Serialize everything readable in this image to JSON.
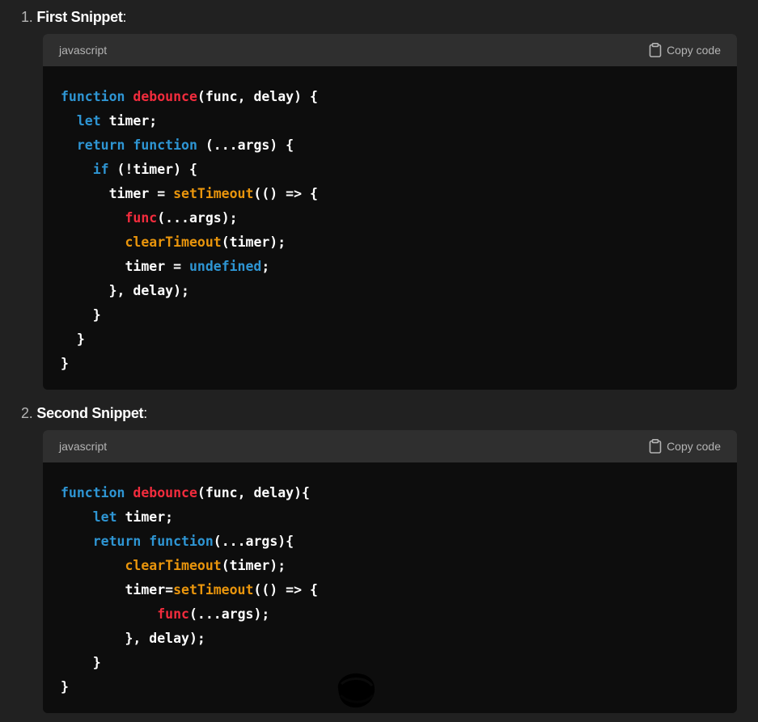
{
  "colors": {
    "background": "#212121",
    "code_background": "#0d0d0d",
    "header_background": "#2f2f2f",
    "keyword": "#2e95d3",
    "function_name": "#f22c3d",
    "builtin": "#e9950c",
    "plain": "#ffffff"
  },
  "snippets": [
    {
      "number": "1.",
      "title": "First Snippet",
      "colon": ":",
      "language": "javascript",
      "copy_label": "Copy code",
      "lines": [
        [
          {
            "t": "function",
            "c": "kw"
          },
          {
            "t": " ",
            "c": "pl"
          },
          {
            "t": "debounce",
            "c": "fn"
          },
          {
            "t": "(func, delay) {",
            "c": "pl"
          }
        ],
        [
          {
            "t": "  ",
            "c": "pl"
          },
          {
            "t": "let",
            "c": "kw"
          },
          {
            "t": " timer;",
            "c": "pl"
          }
        ],
        [
          {
            "t": "  ",
            "c": "pl"
          },
          {
            "t": "return",
            "c": "kw"
          },
          {
            "t": " ",
            "c": "pl"
          },
          {
            "t": "function",
            "c": "kw"
          },
          {
            "t": " (...args) {",
            "c": "pl"
          }
        ],
        [
          {
            "t": "    ",
            "c": "pl"
          },
          {
            "t": "if",
            "c": "kw"
          },
          {
            "t": " (!timer) {",
            "c": "pl"
          }
        ],
        [
          {
            "t": "      timer = ",
            "c": "pl"
          },
          {
            "t": "setTimeout",
            "c": "bi"
          },
          {
            "t": "(() => {",
            "c": "pl"
          }
        ],
        [
          {
            "t": "        ",
            "c": "pl"
          },
          {
            "t": "func",
            "c": "fn"
          },
          {
            "t": "(...args);",
            "c": "pl"
          }
        ],
        [
          {
            "t": "        ",
            "c": "pl"
          },
          {
            "t": "clearTimeout",
            "c": "bi"
          },
          {
            "t": "(timer);",
            "c": "pl"
          }
        ],
        [
          {
            "t": "        timer = ",
            "c": "pl"
          },
          {
            "t": "undefined",
            "c": "kw"
          },
          {
            "t": ";",
            "c": "pl"
          }
        ],
        [
          {
            "t": "      }, delay);",
            "c": "pl"
          }
        ],
        [
          {
            "t": "    }",
            "c": "pl"
          }
        ],
        [
          {
            "t": "  }",
            "c": "pl"
          }
        ],
        [
          {
            "t": "}",
            "c": "pl"
          }
        ]
      ]
    },
    {
      "number": "2.",
      "title": "Second Snippet",
      "colon": ":",
      "language": "javascript",
      "copy_label": "Copy code",
      "lines": [
        [
          {
            "t": "function",
            "c": "kw"
          },
          {
            "t": " ",
            "c": "pl"
          },
          {
            "t": "debounce",
            "c": "fn"
          },
          {
            "t": "(func, delay){",
            "c": "pl"
          }
        ],
        [
          {
            "t": "    ",
            "c": "pl"
          },
          {
            "t": "let",
            "c": "kw"
          },
          {
            "t": " timer;",
            "c": "pl"
          }
        ],
        [
          {
            "t": "    ",
            "c": "pl"
          },
          {
            "t": "return",
            "c": "kw"
          },
          {
            "t": " ",
            "c": "pl"
          },
          {
            "t": "function",
            "c": "kw"
          },
          {
            "t": "(...args){",
            "c": "pl"
          }
        ],
        [
          {
            "t": "        ",
            "c": "pl"
          },
          {
            "t": "clearTimeout",
            "c": "bi"
          },
          {
            "t": "(timer);",
            "c": "pl"
          }
        ],
        [
          {
            "t": "        timer=",
            "c": "pl"
          },
          {
            "t": "setTimeout",
            "c": "bi"
          },
          {
            "t": "(() => {",
            "c": "pl"
          }
        ],
        [
          {
            "t": "            ",
            "c": "pl"
          },
          {
            "t": "func",
            "c": "fn"
          },
          {
            "t": "(...args);",
            "c": "pl"
          }
        ],
        [
          {
            "t": "        }, delay);",
            "c": "pl"
          }
        ],
        [
          {
            "t": "    }",
            "c": "pl"
          }
        ],
        [
          {
            "t": "}",
            "c": "pl"
          }
        ]
      ]
    }
  ]
}
